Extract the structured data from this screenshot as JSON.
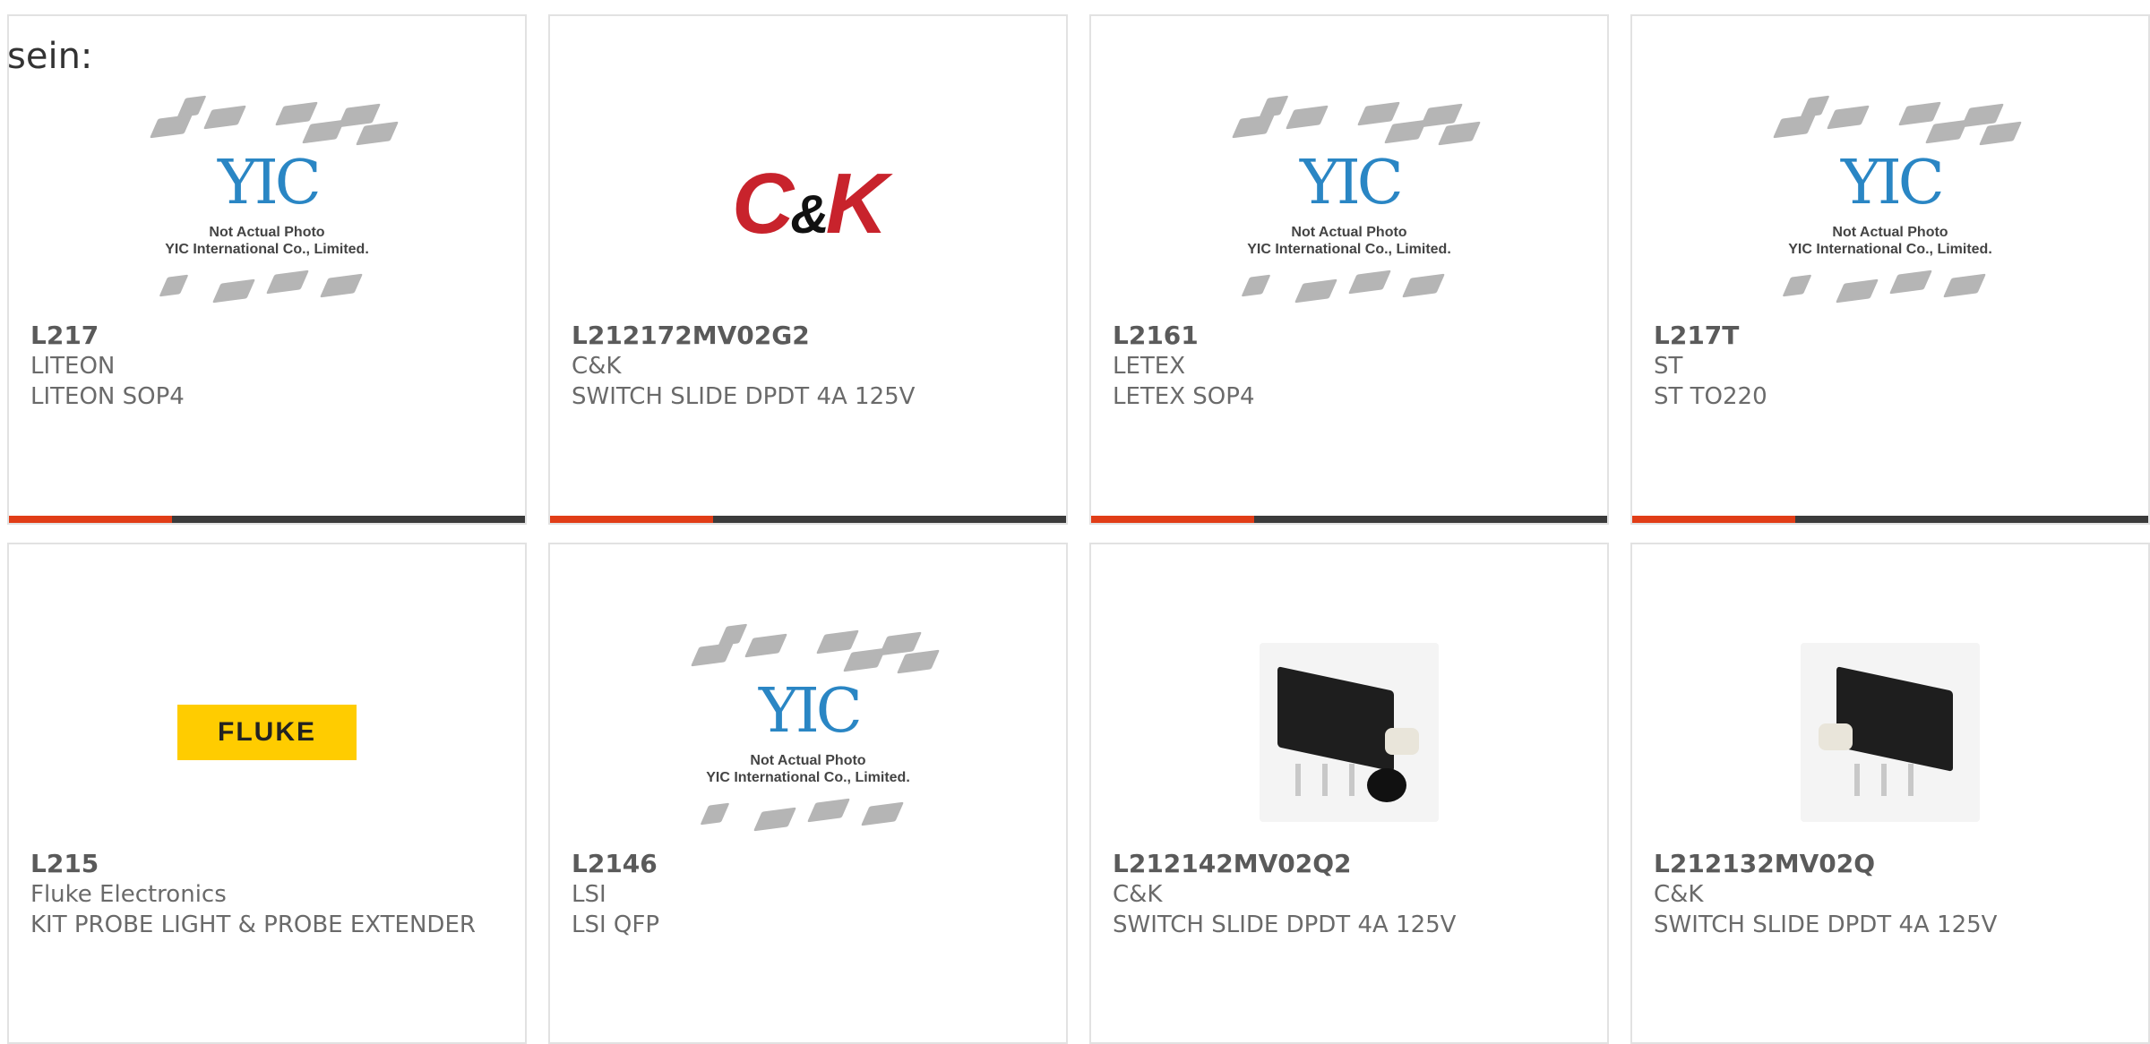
{
  "intro": {
    "text": "sein:"
  },
  "products": [
    {
      "part": "L217",
      "manufacturer": "LITEON",
      "description": "LITEON SOP4",
      "image": "yic-placeholder"
    },
    {
      "part": "L212172MV02G2",
      "manufacturer": "C&K",
      "description": "SWITCH SLIDE DPDT 4A 125V",
      "image": "ck-logo"
    },
    {
      "part": "L2161",
      "manufacturer": "LETEX",
      "description": "LETEX SOP4",
      "image": "yic-placeholder"
    },
    {
      "part": "L217T",
      "manufacturer": "ST",
      "description": "ST TO220",
      "image": "yic-placeholder"
    },
    {
      "part": "L215",
      "manufacturer": "Fluke Electronics",
      "description": "KIT PROBE LIGHT & PROBE EXTENDER",
      "image": "fluke-logo"
    },
    {
      "part": "L2146",
      "manufacturer": "LSI",
      "description": "LSI QFP",
      "image": "yic-placeholder"
    },
    {
      "part": "L212142MV02Q2",
      "manufacturer": "C&K",
      "description": "SWITCH SLIDE DPDT 4A 125V",
      "image": "switch-photo-with-cap"
    },
    {
      "part": "L212132MV02Q",
      "manufacturer": "C&K",
      "description": "SWITCH SLIDE DPDT 4A 125V",
      "image": "switch-photo"
    }
  ],
  "placeholder": {
    "line1": "Not Actual Photo",
    "line2": "YIC International Co., Limited."
  },
  "ck_logo": {
    "c": "C",
    "amp": "&",
    "k": "K"
  },
  "fluke_logo": {
    "text": "FLUKE"
  },
  "colors": {
    "accent": "#e13d17",
    "bar": "#3b3b3b",
    "border": "#e2e2e2"
  }
}
